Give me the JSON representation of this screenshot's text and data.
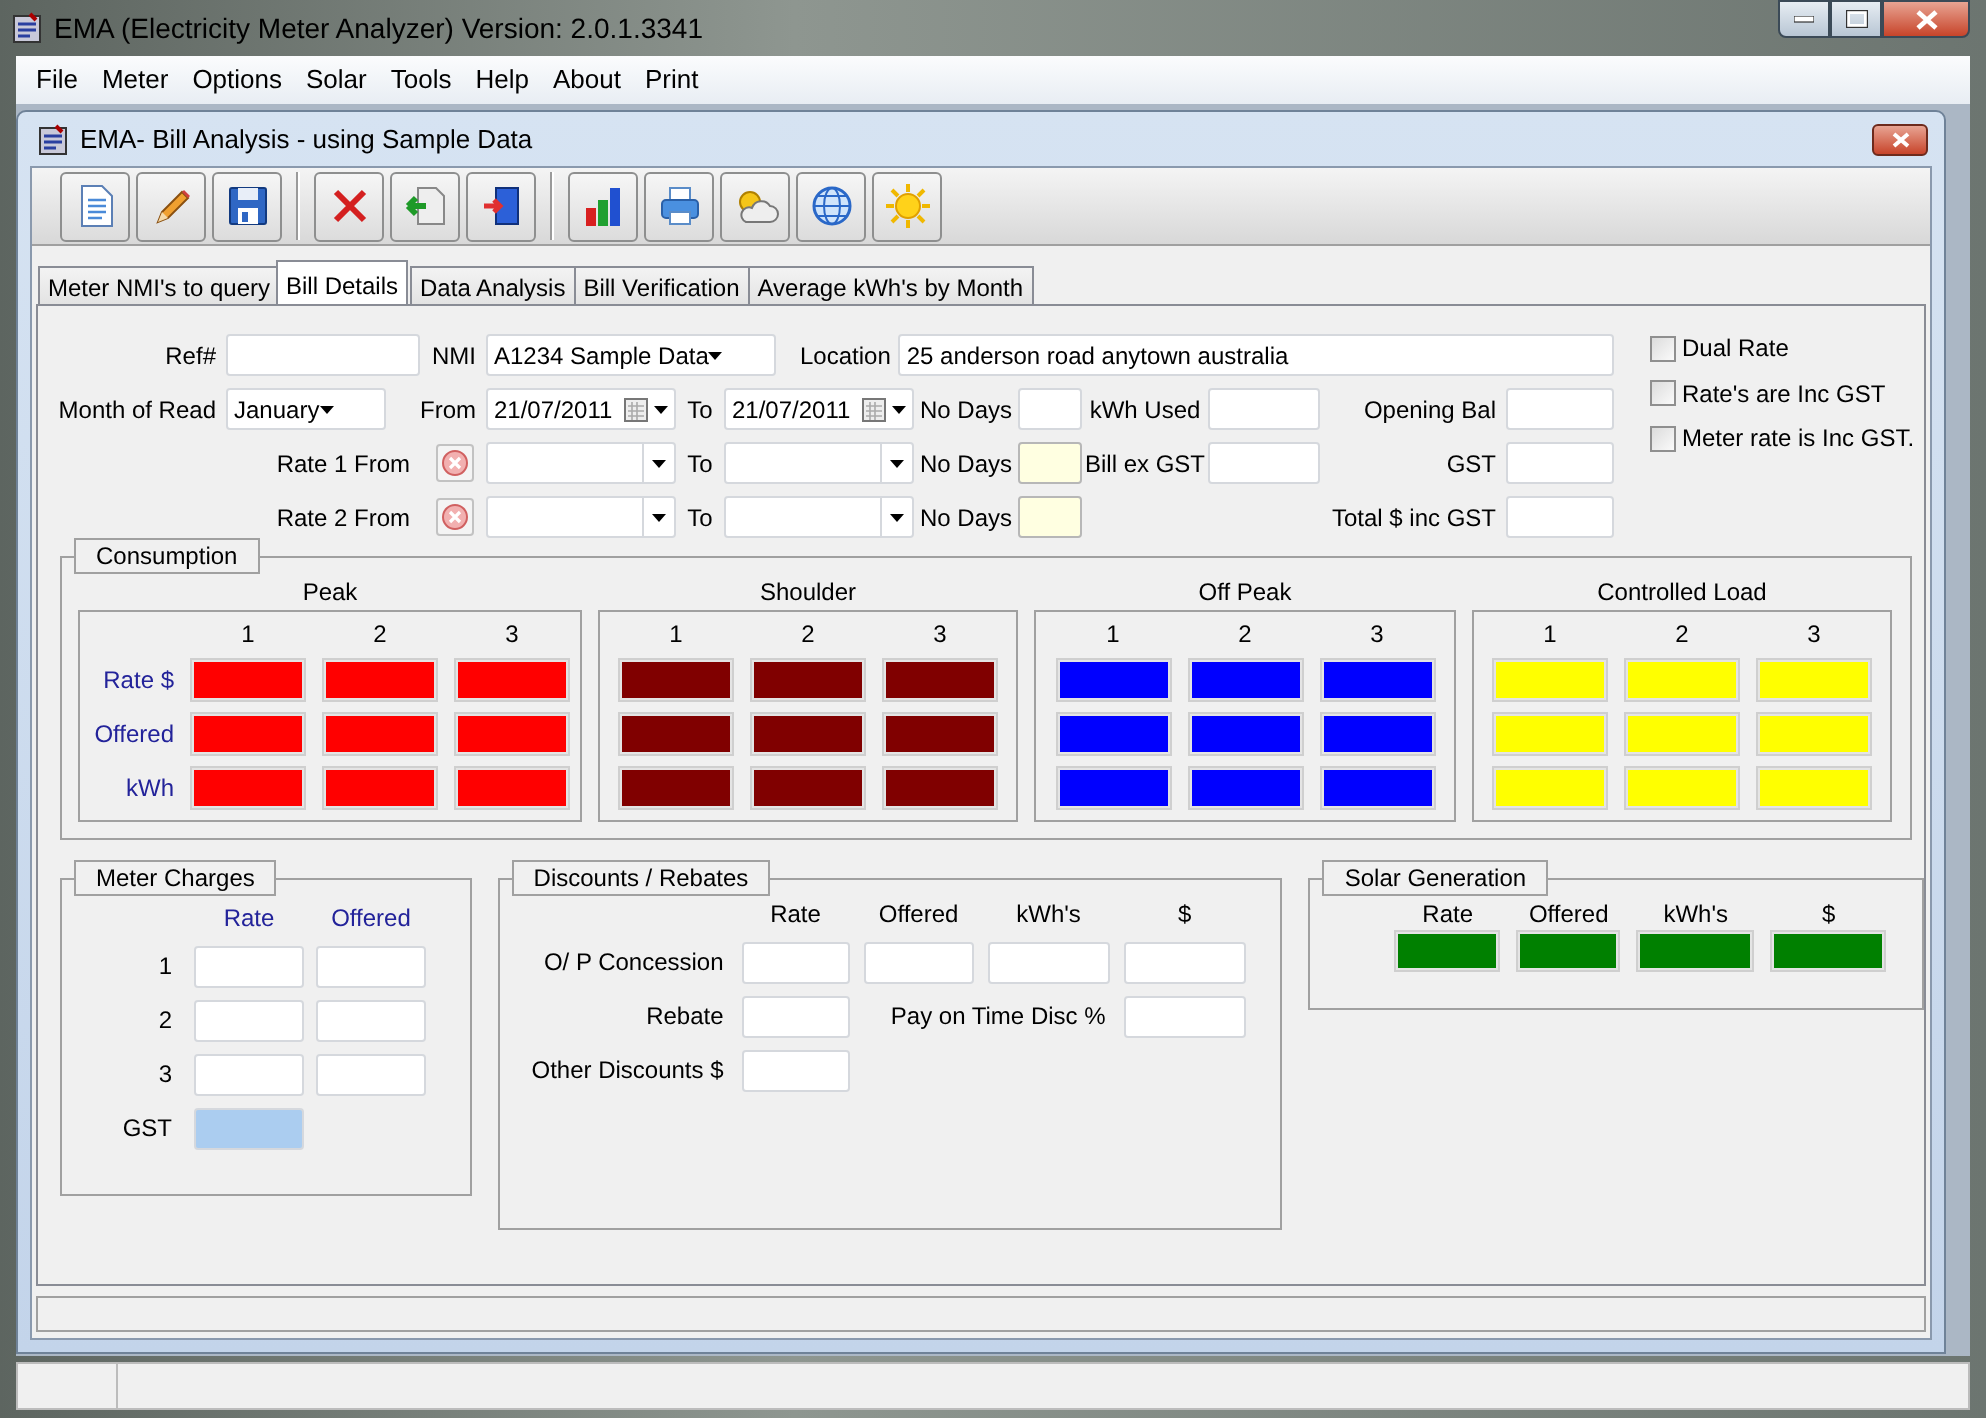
{
  "window": {
    "title": "EMA (Electricity Meter Analyzer) Version: 2.0.1.3341"
  },
  "menu": [
    "File",
    "Meter",
    "Options",
    "Solar",
    "Tools",
    "Help",
    "About",
    "Print"
  ],
  "child_window": {
    "title": "EMA- Bill Analysis - using Sample Data"
  },
  "tabs": [
    {
      "label": "Meter NMI's to query",
      "selected": false
    },
    {
      "label": "Bill Details",
      "selected": true
    },
    {
      "label": "Data Analysis",
      "selected": false
    },
    {
      "label": "Bill Verification",
      "selected": false
    },
    {
      "label": "Average kWh's by Month",
      "selected": false
    }
  ],
  "bill_details": {
    "ref": {
      "label": "Ref#"
    },
    "nmi": {
      "label": "NMI",
      "value": "A1234 Sample Data"
    },
    "location": {
      "label": "Location",
      "value": "25 anderson road anytown australia"
    },
    "month_of_read": {
      "label": "Month of Read",
      "value": "January"
    },
    "from": {
      "label": "From",
      "value": "21/07/2011"
    },
    "to": {
      "label": "To",
      "value": "21/07/2011"
    },
    "no_days": {
      "label": "No Days"
    },
    "kwh_used": {
      "label": "kWh Used"
    },
    "opening_bal": {
      "label": "Opening Bal"
    },
    "rates": [
      {
        "label": "Rate 1 From",
        "to_label": "To",
        "no_days_label": "No Days"
      },
      {
        "label": "Rate 2 From",
        "to_label": "To",
        "no_days_label": "No Days"
      }
    ],
    "bill_ex_gst": {
      "label": "Bill ex GST"
    },
    "gst": {
      "label": "GST"
    },
    "total": {
      "label": "Total $ inc GST"
    },
    "checkboxes": [
      {
        "label": "Dual Rate",
        "checked": false
      },
      {
        "label": "Rate's are Inc GST",
        "checked": false
      },
      {
        "label": "Meter rate is Inc GST.",
        "checked": false
      }
    ]
  },
  "consumption": {
    "title": "Consumption",
    "row_labels": [
      "Rate $",
      "Offered",
      "kWh"
    ],
    "groups": [
      {
        "name": "Peak",
        "color": "#ff0000",
        "columns": [
          "1",
          "2",
          "3"
        ]
      },
      {
        "name": "Shoulder",
        "color": "#800000",
        "columns": [
          "1",
          "2",
          "3"
        ]
      },
      {
        "name": "Off Peak",
        "color": "#0000ff",
        "columns": [
          "1",
          "2",
          "3"
        ]
      },
      {
        "name": "Controlled Load",
        "color": "#ffff00",
        "columns": [
          "1",
          "2",
          "3"
        ]
      }
    ]
  },
  "meter_charges": {
    "title": "Meter Charges",
    "columns": [
      "Rate",
      "Offered"
    ],
    "rows": [
      "1",
      "2",
      "3"
    ],
    "gst_label": "GST"
  },
  "discounts": {
    "title": "Discounts / Rebates",
    "columns": [
      "Rate",
      "Offered",
      "kWh's",
      "$"
    ],
    "op_concession_label": "O/ P Concession",
    "rebate_label": "Rebate",
    "pay_on_time_label": "Pay on Time Disc %",
    "other_label": "Other Discounts $"
  },
  "solar": {
    "title": "Solar Generation",
    "columns": [
      "Rate",
      "Offered",
      "kWh's",
      "$"
    ]
  }
}
